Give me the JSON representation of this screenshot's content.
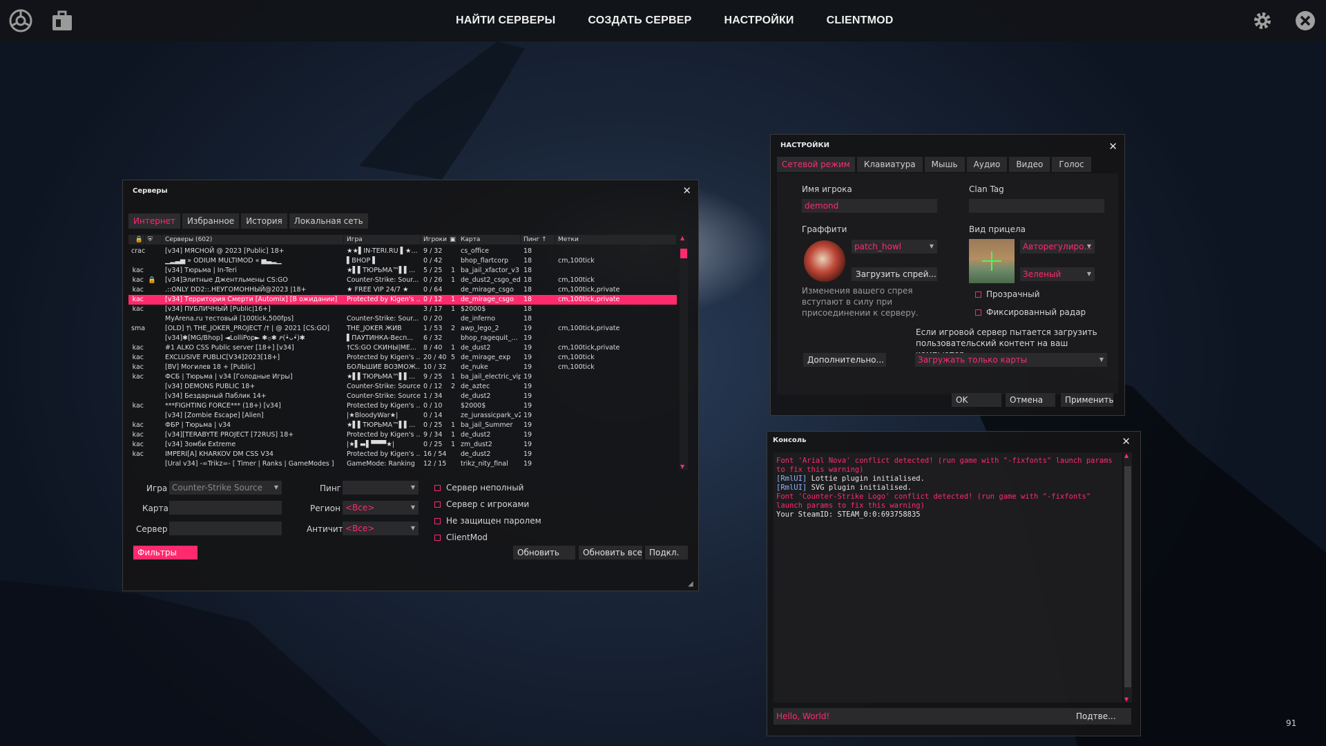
{
  "topbar": {
    "nav": [
      "НАЙТИ СЕРВЕРЫ",
      "СОЗДАТЬ СЕРВЕР",
      "НАСТРОЙКИ",
      "CLIENTMOD"
    ]
  },
  "servers": {
    "title": "Серверы",
    "tabs": [
      "Интернет",
      "Избранное",
      "История",
      "Локальная сеть"
    ],
    "columns": [
      "Серверы (602)",
      "Игра",
      "Игроки",
      "Карта",
      "Пинг ↑",
      "Метки"
    ],
    "rows": [
      [
        "crack",
        "",
        "[v34] МЯСНОЙ @ 2023 [Public] 18+",
        "★★▌IN-TERI.RU ▌★...",
        "9 / 32",
        "",
        "cs_office",
        "18",
        ""
      ],
      [
        "",
        "",
        "▁▂▃▅ » ODIUM MULTIMOD « ▅▃▂▁",
        "▌BHOP ▌",
        "0 / 42",
        "",
        "bhop_flartcorp",
        "18",
        "cm,100tick"
      ],
      [
        "kac",
        "",
        "[v34] Тюрьма | In-Teri",
        "★▌▌ТЮРЬМА™▌▌...",
        "5 / 25",
        "1",
        "ba_jail_xfactor_v3",
        "18",
        ""
      ],
      [
        "kac",
        "lock",
        "[v34]Элитные Джентльмены CS:GO",
        "Counter-Strike: Sour...",
        "0 / 26",
        "1",
        "de_dust2_csgo_ed",
        "18",
        "cm,100tick"
      ],
      [
        "kac",
        "",
        ".::ONLY DD2::.НЕУГОМОННЫЙ@2023 |18+",
        "★ FREE VIP 24/7 ★",
        "0 / 64",
        "",
        "de_mirage_csgo",
        "18",
        "cm,100tick,private"
      ],
      [
        "kac",
        "",
        "[v34] Территория Смерти [Automix] [В ожидании]",
        "Protected by Kigen's ...",
        "0 / 12",
        "1",
        "de_mirage_csgo",
        "18",
        "cm,100tick,private"
      ],
      [
        "kac",
        "",
        "[v34] ПУБЛИЧНЫЙ [Public|16+]",
        "",
        "3 / 17",
        "1",
        "$2000$",
        "18",
        ""
      ],
      [
        "",
        "",
        "MyArena.ru тестовый [100tick,500fps]",
        "Counter-Strike: Sour...",
        "0 / 20",
        "",
        "de_inferno",
        "18",
        ""
      ],
      [
        "smac",
        "",
        "[OLD] †\\ THE_JOKER_PROJECT /† | @ 2021 [CS:GO]",
        "THE_JOKER ЖИВ",
        "1 / 53",
        "2",
        "awp_lego_2",
        "19",
        "cm,100tick,private"
      ],
      [
        "",
        "",
        "[v34]✱[MG/Bhop] ◄LolliPop► ✱۞✱ ዖ(•̀ᴗ•́)✱",
        "▌ПАУТИНКА-Весп...",
        "6 / 32",
        "",
        "bhop_ragequit_...",
        "19",
        ""
      ],
      [
        "kac",
        "",
        "#1 ALKO CSS Public server [18+] [v34]",
        "†CS:GO СКИНЫ|МЕ...",
        "8 / 40",
        "1",
        "de_dust2",
        "19",
        "cm,100tick,private"
      ],
      [
        "kac",
        "",
        "EXCLUSIVE PUBLIC[V34]2023[18+]",
        "Protected by Kigen's ...",
        "20 / 40",
        "5",
        "de_mirage_exp",
        "19",
        "cm,100tick"
      ],
      [
        "kac",
        "",
        "[BV] Могилев 18 + [Public]",
        "БОЛЬШИЕ ВОЗМОЖ...",
        "10 / 32",
        "",
        "de_nuke",
        "19",
        "cm,100tick"
      ],
      [
        "kac",
        "",
        "ФСБ | Тюрьма | v34 [Голодные Игры]",
        "★▌▌ТЮРЬМА™▌▌...",
        "9 / 25",
        "1",
        "ba_jail_electric_vip",
        "19",
        ""
      ],
      [
        "",
        "",
        "[v34] DEMONS PUBLIC 18+",
        "Counter-Strike: Source",
        "0 / 12",
        "2",
        "de_aztec",
        "19",
        ""
      ],
      [
        "",
        "",
        "[v34] Бездарный Паблик 14+",
        "Counter-Strike: Source",
        "1 / 34",
        "",
        "de_dust2",
        "19",
        ""
      ],
      [
        "kac",
        "",
        "***FIGHTING FORCE*** (18+) [v34]",
        "Protected by Kigen's ...",
        "0 / 10",
        "",
        "$2000$",
        "19",
        ""
      ],
      [
        "",
        "",
        "[v34] [Zombie Escape] [Alien]",
        "|★BloodyWar★|",
        "0 / 14",
        "",
        "ze_jurassicpark_v2",
        "19",
        ""
      ],
      [
        "kac",
        "",
        "ФБР | Тюрьма | v34",
        "★▌▌ТЮРЬМА™▌▌...",
        "0 / 25",
        "1",
        "ba_jail_Summer",
        "19",
        ""
      ],
      [
        "kac",
        "",
        "[v34][TERABYTE PROJECT [72RUS] 18+",
        "Protected by Kigen's ...",
        "9 / 34",
        "1",
        "de_dust2",
        "19",
        ""
      ],
      [
        "kac",
        "",
        "[v34] Зомби Extreme",
        "|★▌▬▌▀▀▀★|",
        "0 / 25",
        "1",
        "zm_dust2",
        "19",
        ""
      ],
      [
        "kac",
        "",
        "IMPERI[A] KHARKOV DM CSS V34",
        "Protected by Kigen's ...",
        "16 / 54",
        "",
        "de_dust2",
        "19",
        ""
      ],
      [
        "",
        "",
        "[Ural v34] -=Trikz=- [ Timer | Ranks | GameModes ]",
        "GameMode: Ranking",
        "12 / 15",
        "",
        "trikz_nity_final",
        "19",
        ""
      ]
    ],
    "filters": {
      "game_label": "Игра",
      "game_value": "Counter-Strike Source",
      "map_label": "Карта",
      "server_label": "Сервер",
      "ping_label": "Пинг",
      "region_label": "Регион",
      "region_value": "<Все>",
      "anticheat_label": "Античит",
      "anticheat_value": "<Все>",
      "checks": [
        "Сервер неполный",
        "Сервер с игроками",
        "Не защищен паролем",
        "ClientMod"
      ]
    },
    "buttons": {
      "filters": "Фильтры",
      "refresh": "Обновить",
      "refresh_all": "Обновить все",
      "connect": "Подкл."
    }
  },
  "settings": {
    "title": "НАСТРОЙКИ",
    "tabs": [
      "Сетевой режим",
      "Клавиатура",
      "Мышь",
      "Аудио",
      "Видео",
      "Голос"
    ],
    "player_name_label": "Имя игрока",
    "player_name_value": "demond",
    "clan_tag_label": "Clan Tag",
    "graffiti_label": "Граффити",
    "graffiti_value": "patch_howl",
    "load_spray": "Загрузить спрей...",
    "spray_note": "Изменения вашего спрея вступают в силу при присоединении к серверу.",
    "crosshair_label": "Вид прицела",
    "crosshair_value": "Авторегулиро...",
    "color_value": "Зеленый",
    "transparent": "Прозрачный",
    "fixed_radar": "Фиксированный радар",
    "advanced": "Дополнительно...",
    "content_note": "Если игровой сервер пытается загрузить пользовательский контент на ваш компьютер",
    "content_value": "Загружать только карты",
    "ok": "OK",
    "cancel": "Отмена",
    "apply": "Применить"
  },
  "console": {
    "title": "Консоль",
    "lines": [
      {
        "text": "Font 'Arial Nova' conflict detected! (run game with \"-fixfonts\" launch params to fix this warning)",
        "color": "#ff2a6d"
      },
      {
        "text": "[RmlUI] Lottie plugin initialised.",
        "color": "#e6e6e6",
        "prefix_color": "#8db4ff"
      },
      {
        "text": "[RmlUI] SVG plugin initialised.",
        "color": "#e6e6e6",
        "prefix_color": "#8db4ff"
      },
      {
        "text": "Font 'Counter-Strike Logo' conflict detected! (run game with \"-fixfonts\" launch params to fix this warning)",
        "color": "#ff2a6d"
      },
      {
        "text": "Your SteamID: STEAM_0:0:693758835",
        "color": "#e6e6e6"
      }
    ],
    "input_value": "Hello, World!",
    "submit": "Подтве...",
    "fps": "91"
  },
  "colors": {
    "accent": "#ff2a6d"
  }
}
